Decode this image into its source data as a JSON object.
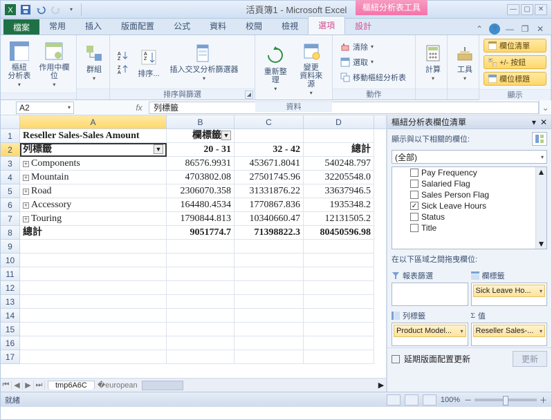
{
  "title": "活頁簿1 - Microsoft Excel",
  "tooltab": "樞紐分析表工具",
  "tabs": {
    "file": "檔案",
    "home": "常用",
    "insert": "插入",
    "layout": "版面配置",
    "formula": "公式",
    "data": "資料",
    "review": "校閱",
    "view": "檢視",
    "options": "選項",
    "design": "設計"
  },
  "ribbon": {
    "g1": {
      "label": "",
      "pivot": "樞紐\n分析表",
      "field": "作用中欄位"
    },
    "g2": {
      "label": "",
      "group": "群組"
    },
    "g3": {
      "label": "排序與篩選",
      "sortA": "A↓Z",
      "sortZ": "Z↓A",
      "sort": "排序...",
      "slicer": "插入交叉分析篩選器"
    },
    "g4": {
      "label": "資料",
      "refresh": "重新整理",
      "source": "變更\n資料來源"
    },
    "g5": {
      "label": "動作",
      "clear": "清除",
      "select": "選取",
      "move": "移動樞紐分析表"
    },
    "g6": {
      "label": "",
      "calc": "計算"
    },
    "g7": {
      "label": "",
      "tools": "工具"
    },
    "g8": {
      "label": "顯示",
      "fieldlist": "欄位清單",
      "buttons": "+/- 按鈕",
      "headers": "欄位標題"
    }
  },
  "namebox": "A2",
  "fx": "列標籤",
  "cols": {
    "A": "A",
    "B": "B",
    "C": "C",
    "D": "D"
  },
  "colw": {
    "A": 212,
    "B": 98,
    "C": 100,
    "D": 102
  },
  "grid": {
    "r1": {
      "A": "Reseller Sales-Sales Amount",
      "B": "欄標籤"
    },
    "r2": {
      "A": "列標籤",
      "B": "20 - 31",
      "C": "32 - 42",
      "D": "總計"
    },
    "r3": {
      "A": "Components",
      "B": "86576.9931",
      "C": "453671.8041",
      "D": "540248.797"
    },
    "r4": {
      "A": "Mountain",
      "B": "4703802.08",
      "C": "27501745.96",
      "D": "32205548.0"
    },
    "r5": {
      "A": "Road",
      "B": "2306070.358",
      "C": "31331876.22",
      "D": "33637946.5"
    },
    "r6": {
      "A": "Accessory",
      "B": "164480.4534",
      "C": "1770867.836",
      "D": "1935348.2"
    },
    "r7": {
      "A": "Touring",
      "B": "1790844.813",
      "C": "10340660.47",
      "D": "12131505.2"
    },
    "r8": {
      "A": "總計",
      "B": "9051774.7",
      "C": "71398822.3",
      "D": "80450596.98"
    }
  },
  "sheet": "tmp6A6C",
  "status": {
    "ready": "就緒",
    "zoom": "100%",
    "minus": "－",
    "plus": "＋"
  },
  "pane": {
    "title": "樞紐分析表欄位清單",
    "choose": "顯示與以下相關的欄位:",
    "all": "(全部)",
    "drag": "在以下區域之間拖曳欄位:",
    "fields": [
      {
        "name": "Pay Frequency",
        "checked": false
      },
      {
        "name": "Salaried Flag",
        "checked": false
      },
      {
        "name": "Sales Person Flag",
        "checked": false
      },
      {
        "name": "Sick Leave Hours",
        "checked": true
      },
      {
        "name": "Status",
        "checked": false
      },
      {
        "name": "Title",
        "checked": false
      }
    ],
    "areas": {
      "filter": "報表篩選",
      "cols": "欄標籤",
      "rows": "列標籤",
      "vals": "值",
      "colitem": "Sick Leave Ho...",
      "rowitem": "Product Model...",
      "valitem": "Reseller Sales-..."
    },
    "defer": "延期版面配置更新",
    "update": "更新"
  }
}
